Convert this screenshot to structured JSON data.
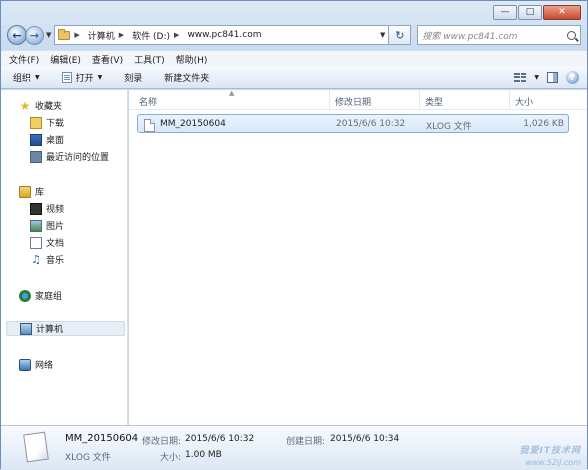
{
  "window": {
    "caption_buttons": [
      "minimize",
      "maximize",
      "close"
    ]
  },
  "address": {
    "segments": [
      "计算机",
      "软件 (D:)",
      "www.pc841.com"
    ],
    "search_placeholder": "搜索 www.pc841.com"
  },
  "menubar": {
    "items": [
      "文件(F)",
      "编辑(E)",
      "查看(V)",
      "工具(T)",
      "帮助(H)"
    ]
  },
  "toolbar": {
    "organize": "组织",
    "open": "打开",
    "burn": "刻录",
    "new_folder": "新建文件夹"
  },
  "nav": {
    "favorites": "收藏夹",
    "downloads": "下载",
    "desktop": "桌面",
    "recent": "最近访问的位置",
    "libraries": "库",
    "videos": "视频",
    "pictures": "图片",
    "documents": "文档",
    "music": "音乐",
    "homegroup": "家庭组",
    "computer": "计算机",
    "network": "网络"
  },
  "columns": {
    "name": "名称",
    "modified": "修改日期",
    "type": "类型",
    "size": "大小"
  },
  "files": [
    {
      "name": "MM_20150604",
      "modified": "2015/6/6 10:32",
      "type": "XLOG 文件",
      "size": "1,026 KB"
    }
  ],
  "details": {
    "name": "MM_20150604",
    "type": "XLOG 文件",
    "modified_label": "修改日期:",
    "modified_value": "2015/6/6 10:32",
    "created_label": "创建日期:",
    "created_value": "2015/6/6 10:34",
    "size_label": "大小:",
    "size_value": "1.00 MB"
  },
  "watermark": {
    "text": "我爱IT技术网",
    "url": "www.52ij.com"
  }
}
